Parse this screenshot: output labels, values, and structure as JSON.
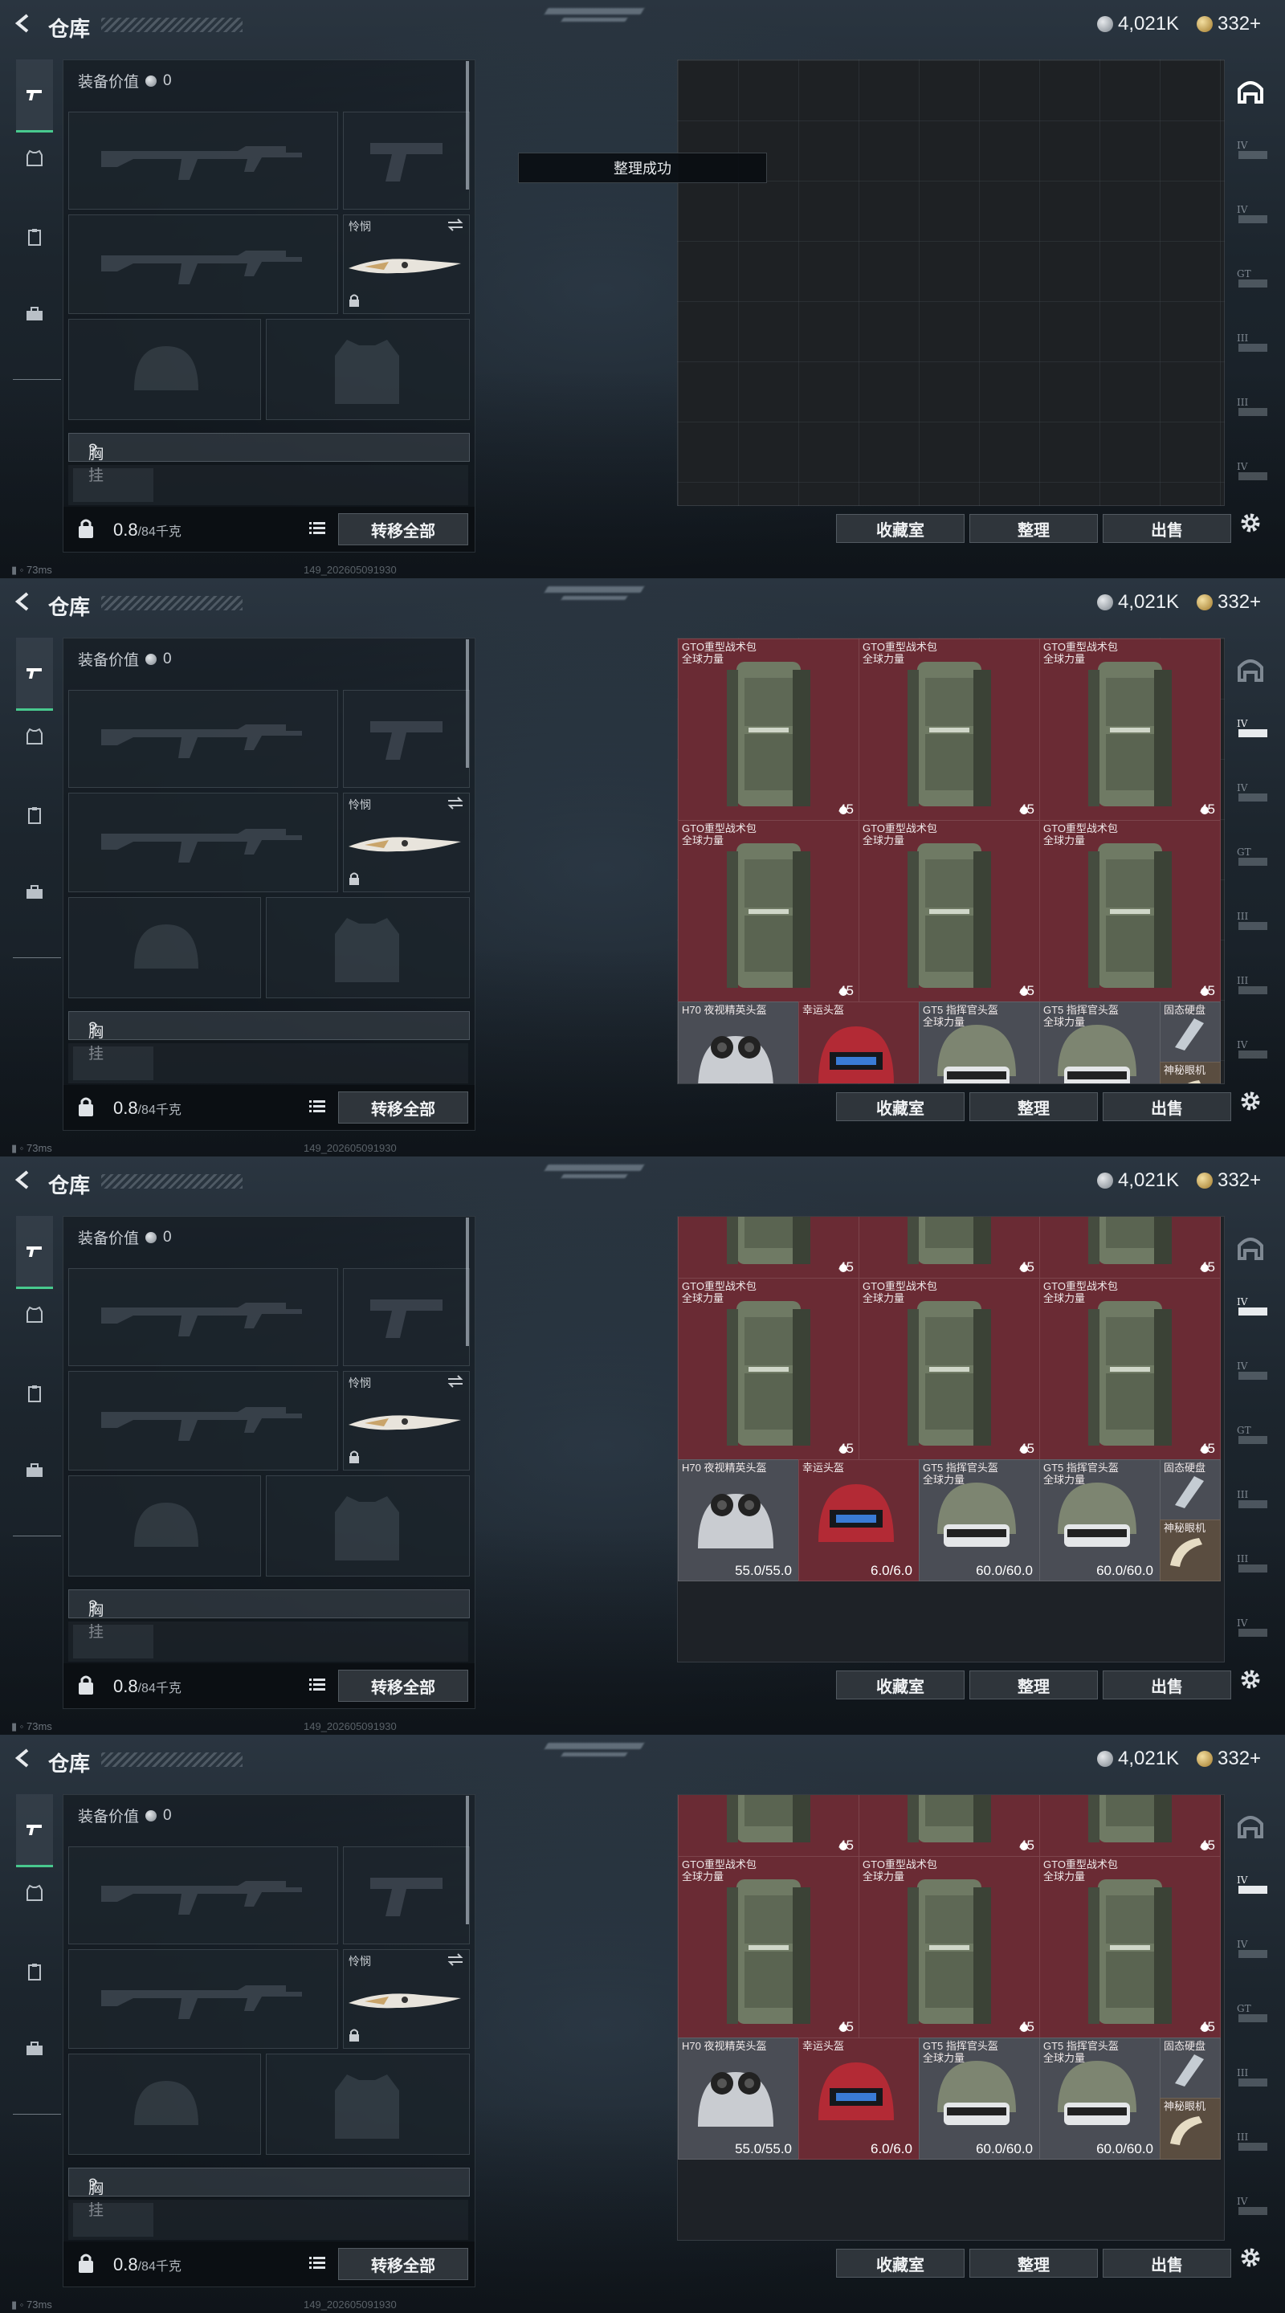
{
  "header": {
    "title": "仓库",
    "silver": "4,021K",
    "gold": "332+"
  },
  "equipment": {
    "value_label": "装备价值",
    "value": "0",
    "melee_label": "怜悯",
    "chest_label": "胸挂",
    "chest_help": "?",
    "weight_value": "0.8",
    "weight_max": "/84千克",
    "transfer_all": "转移全部"
  },
  "stash": {
    "buttons": {
      "collection": "收藏室",
      "organize": "整理",
      "sell": "出售"
    },
    "toast": "整理成功"
  },
  "items": {
    "backpack": {
      "name": "GTO重型战术包\n全球力量",
      "count": "45"
    },
    "helmets": [
      {
        "name": "H70 夜视精英头盔",
        "durability": "55.0/55.0"
      },
      {
        "name": "幸运头盔",
        "durability": "6.0/6.0"
      },
      {
        "name": "GT5 指挥官头盔\n全球力量",
        "durability": "60.0/60.0"
      },
      {
        "name": "GT5 指挥官头盔\n全球力量",
        "durability": "60.0/60.0"
      }
    ],
    "small": [
      {
        "name": "固态硬盘"
      },
      {
        "name": "神秘眼机"
      }
    ]
  },
  "status": {
    "ping": "73ms",
    "version": "149_202605091930"
  },
  "colors": {
    "item_red": "#6a2b34",
    "accent_green": "#48c98e",
    "background": "#1b232b"
  }
}
